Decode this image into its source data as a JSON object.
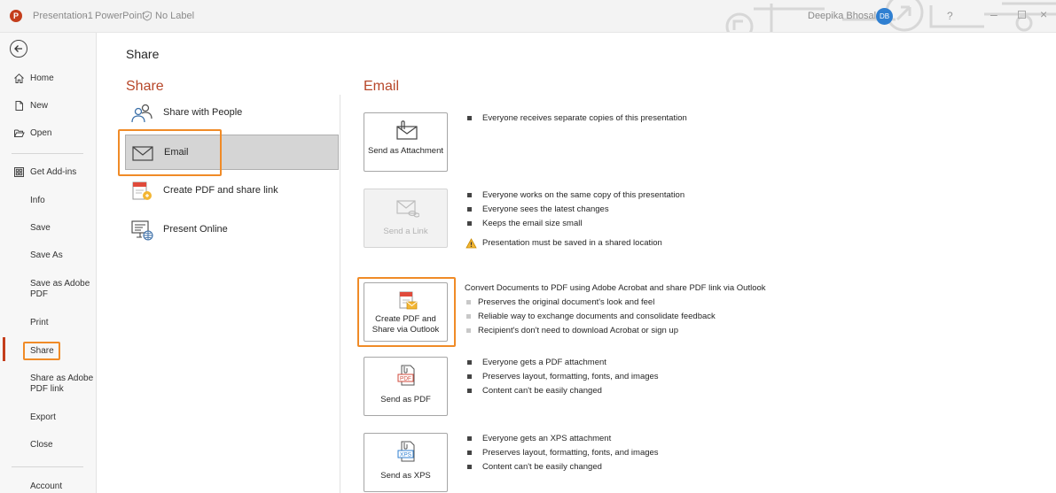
{
  "window": {
    "file_name": "Presentation1",
    "separator": "-",
    "app_name": "PowerPoint",
    "label": "No Label",
    "user_name": "Deepika Bhosale",
    "user_initials": "DB",
    "help_glyph": "?",
    "accent_color": "#c43e1c"
  },
  "nav": {
    "items": [
      {
        "label": "Home",
        "icon": "home-icon"
      },
      {
        "label": "New",
        "icon": "new-document-icon"
      },
      {
        "label": "Open",
        "icon": "folder-open-icon"
      },
      {
        "label": "Get Add-ins",
        "icon": "add-ins-grid-icon"
      },
      {
        "label": "Info"
      },
      {
        "label": "Save"
      },
      {
        "label": "Save As"
      },
      {
        "label": "Save as Adobe PDF"
      },
      {
        "label": "Print"
      },
      {
        "label": "Share"
      },
      {
        "label": "Share as Adobe PDF link"
      },
      {
        "label": "Export"
      },
      {
        "label": "Close"
      },
      {
        "label": "Account"
      }
    ],
    "active": "Share"
  },
  "page": {
    "title": "Share",
    "share_heading": "Share",
    "email_heading": "Email"
  },
  "share_options": [
    {
      "label": "Share with People",
      "icon": "people-icon"
    },
    {
      "label": "Email",
      "icon": "envelope-icon"
    },
    {
      "label": "Create PDF and share link",
      "icon": "pdf-link-icon"
    },
    {
      "label": "Present Online",
      "icon": "present-online-icon"
    }
  ],
  "email_actions": [
    {
      "label": "Send as Attachment",
      "bullets": [
        "Everyone receives separate copies of this presentation"
      ]
    },
    {
      "label": "Send a Link",
      "disabled": true,
      "bullets": [
        "Everyone works on the same copy of this presentation",
        "Everyone sees the latest changes",
        "Keeps the email size small"
      ],
      "warning": "Presentation must be saved in a shared location"
    },
    {
      "label": "Create PDF and Share via Outlook",
      "intro": "Convert Documents to PDF using Adobe Acrobat and share PDF link via Outlook",
      "bullets": [
        "Preserves the original document's look and feel",
        "Reliable way to exchange documents and consolidate feedback",
        "Recipient's don't need to download Acrobat or sign up"
      ]
    },
    {
      "label": "Send as PDF",
      "icon_text": "PDF",
      "bullets": [
        "Everyone gets a PDF attachment",
        "Preserves layout, formatting, fonts, and images",
        "Content can't be easily changed"
      ]
    },
    {
      "label": "Send as XPS",
      "icon_text": "XPS",
      "bullets": [
        "Everyone gets an XPS attachment",
        "Preserves layout, formatting, fonts, and images",
        "Content can't be easily changed"
      ]
    }
  ]
}
